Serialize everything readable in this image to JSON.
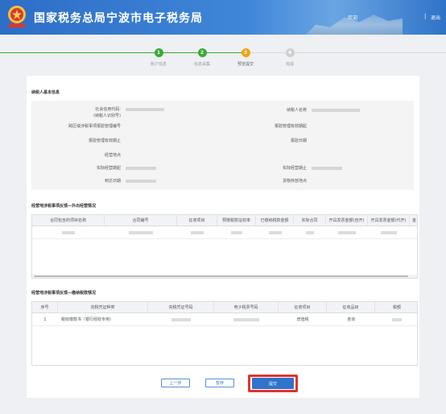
{
  "header": {
    "site_title": "国家税务总局宁波市电子税务局",
    "welcome": "欢迎",
    "logout": "退出",
    "separator": "|"
  },
  "steps": [
    {
      "num": "1",
      "label": "账户信息",
      "state": "done"
    },
    {
      "num": "2",
      "label": "信息采集",
      "state": "done"
    },
    {
      "num": "3",
      "label": "预览提交",
      "state": "current"
    },
    {
      "num": "4",
      "label": "完成",
      "state": "todo"
    }
  ],
  "colors": {
    "done": "#3aa935",
    "current": "#f4a20f",
    "todo": "#cfcfcf",
    "primary": "#2f74c9",
    "highlight": "#e0322d"
  },
  "taxpayer_section": {
    "title": "纳税人基本信息",
    "fields": {
      "credit_code_label": "社会信用代码:",
      "credit_code_sub": "(纳税人识别号)",
      "name_label": "纳税人名称",
      "cert_no_label": "跨区域涉税事项报验管理编号",
      "valid_from_label": "报验管理有效期起",
      "valid_to_label": "报验管理有效期止",
      "report_date_label": "报验日期",
      "biz_addr_label": "经营地点",
      "actual_start_label": "实际经营期起",
      "actual_end_label": "实际经营期止",
      "arrive_date_label": "到达日期",
      "goods_addr_label": "货物存放地点"
    }
  },
  "contract_section": {
    "title": "经营地涉税事项反馈—外出经营情况",
    "columns": [
      "合同包含的项目名称",
      "合同编号",
      "征收项目",
      "预缴税款征收率",
      "已缴纳税款金额",
      "实际合同",
      "开具发票金额(自开)",
      "开具发票金额(代开)",
      "金"
    ]
  },
  "tax_section": {
    "title": "经营地涉税事项反馈—缴纳税款情况",
    "columns": [
      "序号",
      "完税凭证种类",
      "完税凭证号码",
      "电子税票号码",
      "征收项目",
      "征收品目",
      "税额"
    ],
    "rows": [
      {
        "seq": "1",
        "type": "税收缴款书（银行经收专用）",
        "item": "增值税",
        "subitem": "咨询"
      }
    ]
  },
  "buttons": {
    "prev": "上一步",
    "save": "暂存",
    "submit": "提交"
  }
}
